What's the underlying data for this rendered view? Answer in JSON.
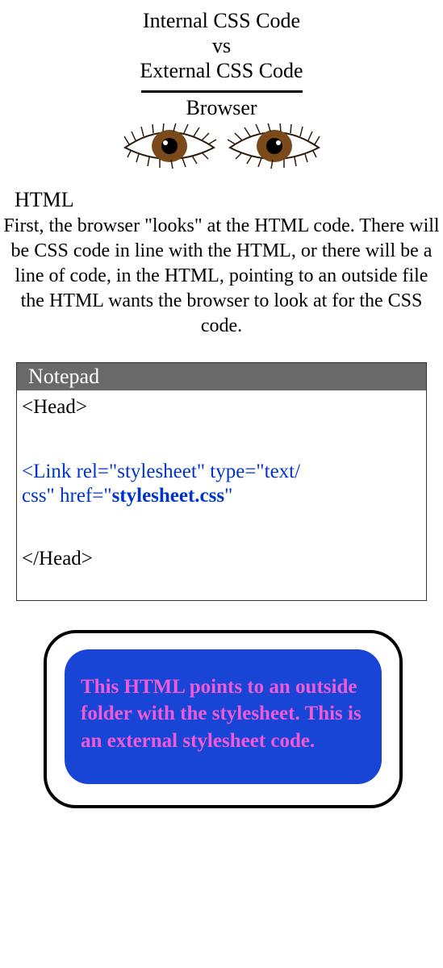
{
  "title": {
    "line1": "Internal CSS Code",
    "line2": "vs",
    "line3": "External CSS Code"
  },
  "browser_label": "Browser",
  "html_label": "HTML",
  "description": "First, the browser \"looks\" at the HTML code. There will be CSS code in line with the HTML, or there will be a line of code, in the HTML, pointing to an outside file the HTML wants the browser to look at for the CSS code.",
  "notepad": {
    "title": "Notepad",
    "head_open": "<Head>",
    "link_part1": "<Link rel=\"stylesheet\" type=\"text/",
    "link_part2a": "css\" href=\"",
    "link_part2b": "stylesheet.css",
    "link_part2c": "\"",
    "head_close": "</Head>"
  },
  "callout": "This HTML points to an outside folder with the stylesheet. This is an external stylesheet code."
}
